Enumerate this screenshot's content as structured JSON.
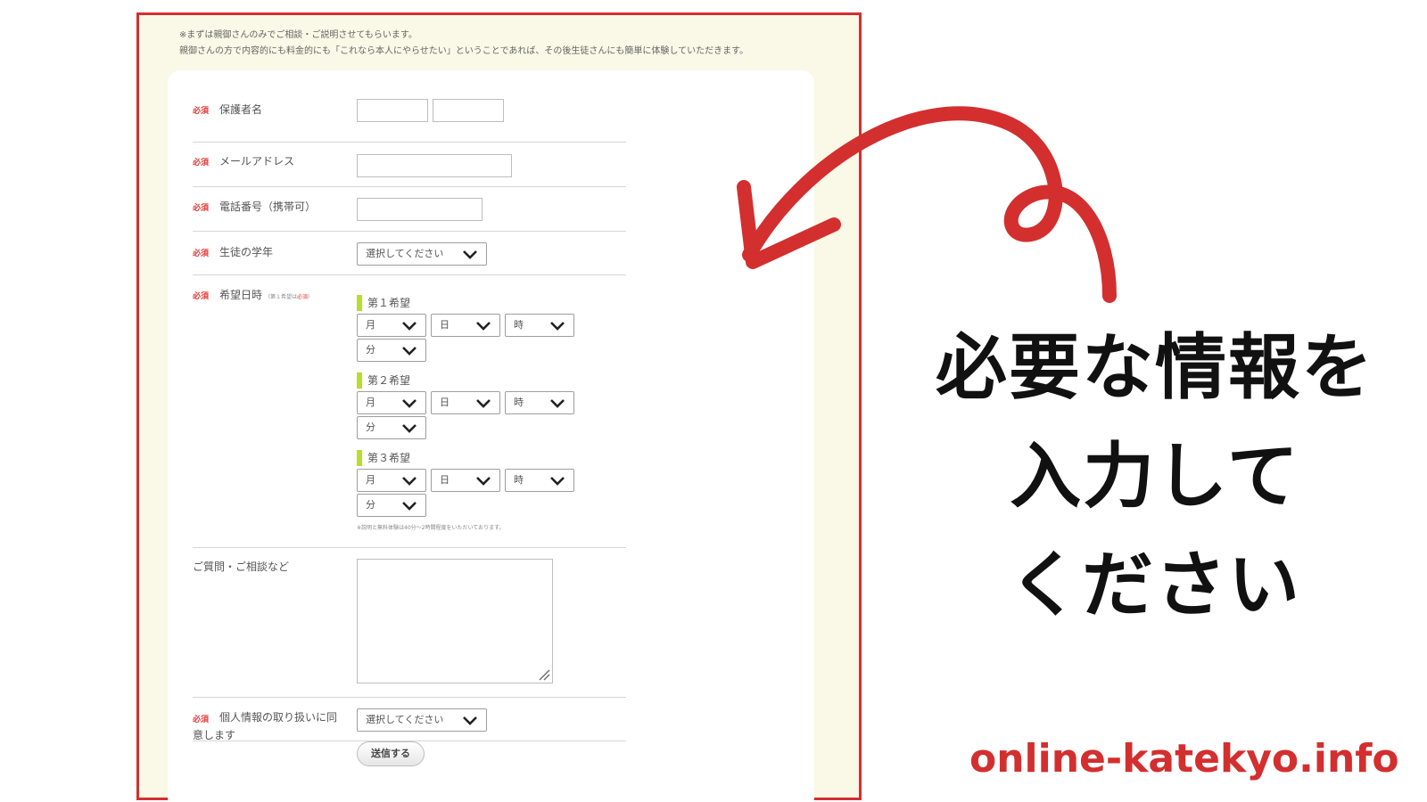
{
  "intro": {
    "line1": "※まずは親御さんのみでご相談・ご説明させてもらいます。",
    "line2": "親御さんの方で内容的にも料金的にも「これなら本人にやらせたい」ということであれば、その後生徒さんにも簡単に体験していただきます。"
  },
  "required_badge": "必須",
  "fields": {
    "guardian_name": "保護者名",
    "email": "メールアドレス",
    "phone": "電話番号（携帯可）",
    "grade": "生徒の学年",
    "datetime": "希望日時",
    "datetime_note_prefix": "（第１希望は",
    "datetime_note_required": "必須",
    "datetime_note_suffix": "）",
    "questions": "ご質問・ご相談など",
    "privacy_line1": "個人情報の取り扱いに同",
    "privacy_line2": "意します"
  },
  "select_placeholder": "選択してください",
  "preferences": [
    {
      "label": "第１希望",
      "month": "月",
      "day": "日",
      "hour": "時",
      "minute": "分"
    },
    {
      "label": "第２希望",
      "month": "月",
      "day": "日",
      "hour": "時",
      "minute": "分"
    },
    {
      "label": "第３希望",
      "month": "月",
      "day": "日",
      "hour": "時",
      "minute": "分"
    }
  ],
  "datetime_footnote": "※説明と無料体験は40分～2時間程度をいただいております。",
  "submit_label": "送信する",
  "caption": {
    "line1": "必要な情報を",
    "line2": "入力して",
    "line3": "ください"
  },
  "site": "online-katekyo.info",
  "colors": {
    "frame": "#d32f2f",
    "arrow": "#d32f2f",
    "badge": "#e53935",
    "pref_bar": "#b7df2a",
    "page_bg": "#faf8e6"
  },
  "icons": {
    "select_arrow": "chevron-down-icon",
    "resize": "resize-handle-icon",
    "callout": "curved-arrow-icon"
  }
}
